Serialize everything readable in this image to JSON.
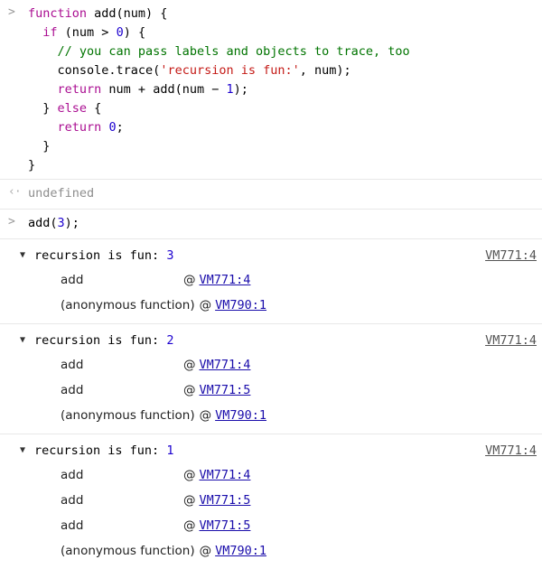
{
  "console": {
    "input_prompt_icon": "chevron-right-icon",
    "result_prompt_icon": "chevron-left-dot-icon",
    "expanded_icon": "triangle-down-icon",
    "colors": {
      "keyword": "#aa0d91",
      "number": "#1c00cf",
      "string": "#c41a16",
      "comment": "#007400",
      "link": "#1a0dab",
      "origin_link": "#555555",
      "undefined_text": "#8d8d8d",
      "separator": "#e8e8e8",
      "background": "#ffffff"
    },
    "code_entry": {
      "lines": [
        [
          {
            "t": "function ",
            "c": "kw"
          },
          {
            "t": "add(num) {",
            "c": ""
          }
        ],
        [
          {
            "t": "  ",
            "c": ""
          },
          {
            "t": "if",
            "c": "kw"
          },
          {
            "t": " (num > ",
            "c": ""
          },
          {
            "t": "0",
            "c": "num"
          },
          {
            "t": ") {",
            "c": ""
          }
        ],
        [
          {
            "t": "    ",
            "c": ""
          },
          {
            "t": "// you can pass labels and objects to trace, too",
            "c": "com"
          }
        ],
        [
          {
            "t": "    console.trace(",
            "c": ""
          },
          {
            "t": "'recursion is fun:'",
            "c": "str"
          },
          {
            "t": ", num);",
            "c": ""
          }
        ],
        [
          {
            "t": "    ",
            "c": ""
          },
          {
            "t": "return",
            "c": "kw"
          },
          {
            "t": " num + add(num ",
            "c": ""
          },
          {
            "t": "−",
            "c": ""
          },
          {
            "t": " ",
            "c": ""
          },
          {
            "t": "1",
            "c": "num"
          },
          {
            "t": ");",
            "c": ""
          }
        ],
        [
          {
            "t": "  } ",
            "c": ""
          },
          {
            "t": "else",
            "c": "kw"
          },
          {
            "t": " {",
            "c": ""
          }
        ],
        [
          {
            "t": "    ",
            "c": ""
          },
          {
            "t": "return",
            "c": "kw"
          },
          {
            "t": " ",
            "c": ""
          },
          {
            "t": "0",
            "c": "num"
          },
          {
            "t": ";",
            "c": ""
          }
        ],
        [
          {
            "t": "  }",
            "c": ""
          }
        ],
        [
          {
            "t": "}",
            "c": ""
          }
        ]
      ]
    },
    "result_entry": {
      "text": "undefined"
    },
    "call_entry": {
      "parts": [
        {
          "t": "add(",
          "c": ""
        },
        {
          "t": "3",
          "c": "num"
        },
        {
          "t": ");",
          "c": ""
        }
      ]
    },
    "trace_groups": [
      {
        "label": "recursion is fun: ",
        "value": "3",
        "origin": "VM771:4",
        "frames": [
          {
            "fn": "add",
            "at": "@",
            "link": "VM771:4",
            "anon": false
          },
          {
            "fn": "(anonymous function)",
            "at": "@",
            "link": "VM790:1",
            "anon": true
          }
        ]
      },
      {
        "label": "recursion is fun: ",
        "value": "2",
        "origin": "VM771:4",
        "frames": [
          {
            "fn": "add",
            "at": "@",
            "link": "VM771:4",
            "anon": false
          },
          {
            "fn": "add",
            "at": "@",
            "link": "VM771:5",
            "anon": false
          },
          {
            "fn": "(anonymous function)",
            "at": "@",
            "link": "VM790:1",
            "anon": true
          }
        ]
      },
      {
        "label": "recursion is fun: ",
        "value": "1",
        "origin": "VM771:4",
        "frames": [
          {
            "fn": "add",
            "at": "@",
            "link": "VM771:4",
            "anon": false
          },
          {
            "fn": "add",
            "at": "@",
            "link": "VM771:5",
            "anon": false
          },
          {
            "fn": "add",
            "at": "@",
            "link": "VM771:5",
            "anon": false
          },
          {
            "fn": "(anonymous function)",
            "at": "@",
            "link": "VM790:1",
            "anon": true
          }
        ]
      }
    ]
  }
}
